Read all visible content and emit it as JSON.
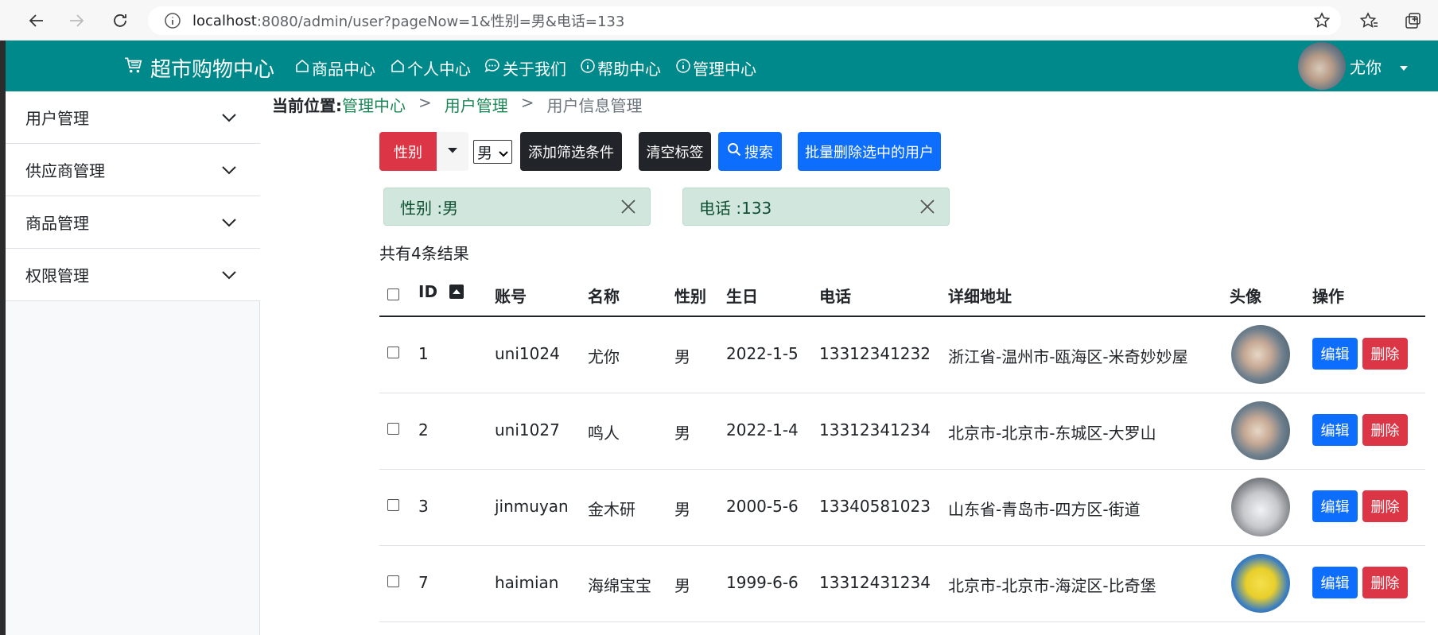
{
  "browser": {
    "url_host": "localhost",
    "url_path": ":8080/admin/user?pageNow=1&性别=男&电话=133"
  },
  "topnav": {
    "brand": "超市购物中心",
    "links": [
      "商品中心",
      "个人中心",
      "关于我们",
      "帮助中心",
      "管理中心"
    ],
    "username": "尤你"
  },
  "sidebar": {
    "items": [
      {
        "label": "用户管理"
      },
      {
        "label": "供应商管理"
      },
      {
        "label": "商品管理"
      },
      {
        "label": "权限管理"
      }
    ]
  },
  "breadcrumb": {
    "label": "当前位置:",
    "link1": "管理中心",
    "sep": ">",
    "link2": "用户管理",
    "current": "用户信息管理"
  },
  "filters": {
    "field_button": "性别",
    "selected_value": "男",
    "add_button": "添加筛选条件",
    "clear_button": "清空标签",
    "search_button": "搜索",
    "batch_delete_button": "批量删除选中的用户"
  },
  "tags": [
    {
      "text": "性别 :男"
    },
    {
      "text": "电话 :133"
    }
  ],
  "result_text": "共有4条结果",
  "table": {
    "headers": [
      "ID",
      "账号",
      "名称",
      "性别",
      "生日",
      "电话",
      "详细地址",
      "头像",
      "操作"
    ],
    "rows": [
      {
        "id": "1",
        "account": "uni1024",
        "name": "尤你",
        "sex": "男",
        "birthday": "2022-1-5",
        "phone": "13312341232",
        "address": "浙江省-温州市-瓯海区-米奇妙妙屋",
        "edit": "编辑",
        "delete": "删除"
      },
      {
        "id": "2",
        "account": "uni1027",
        "name": "鸣人",
        "sex": "男",
        "birthday": "2022-1-4",
        "phone": "13312341234",
        "address": "北京市-北京市-东城区-大罗山",
        "edit": "编辑",
        "delete": "删除"
      },
      {
        "id": "3",
        "account": "jinmuyan",
        "name": "金木研",
        "sex": "男",
        "birthday": "2000-5-6",
        "phone": "13340581023",
        "address": "山东省-青岛市-四方区-街道",
        "edit": "编辑",
        "delete": "删除"
      },
      {
        "id": "7",
        "account": "haimian",
        "name": "海绵宝宝",
        "sex": "男",
        "birthday": "1999-6-6",
        "phone": "13312431234",
        "address": "北京市-北京市-海淀区-比奇堡",
        "edit": "编辑",
        "delete": "删除"
      }
    ]
  },
  "colors": {
    "nav": "#00898a",
    "primary": "#0d6efd",
    "danger": "#dc3545",
    "dark": "#212529",
    "tag_bg": "#d1e7dd",
    "link": "#198754"
  }
}
